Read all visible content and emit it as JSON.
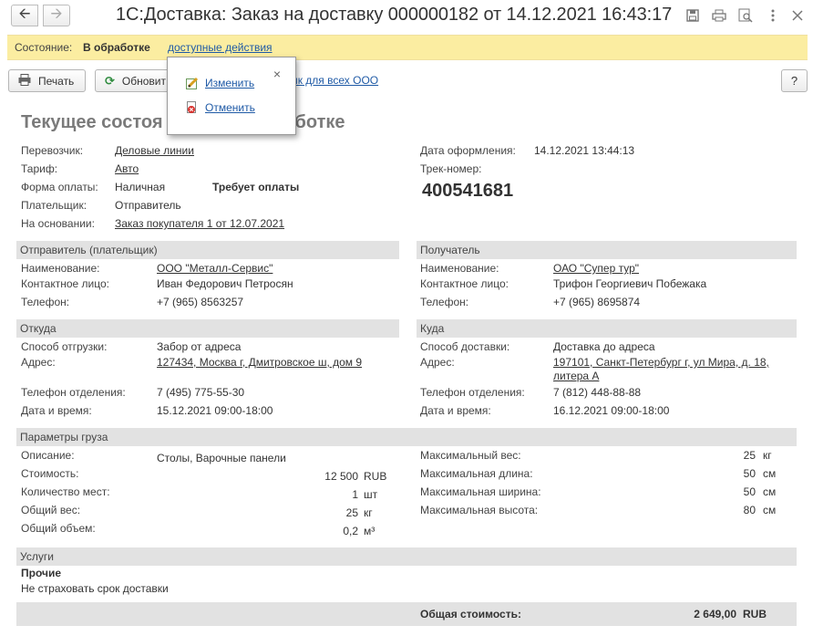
{
  "window": {
    "title": "1С:Доставка: Заказ на доставку 000000182 от 14.12.2021 16:43:17"
  },
  "status": {
    "label": "Состояние:",
    "value": "В обработке",
    "actions_link": "доступные действия"
  },
  "toolbar": {
    "print_label": "Печать",
    "refresh_label": "Обновит",
    "link_label": "ик для всех ООО",
    "help_label": "?"
  },
  "popup": {
    "edit_label": "Изменить",
    "cancel_label": "Отменить",
    "close": "×"
  },
  "heading": {
    "left": "Текущее состоя",
    "right": "ботке"
  },
  "general": {
    "carrier_label": "Перевозчик:",
    "carrier": "Деловые линии",
    "tariff_label": "Тариф:",
    "tariff": "Авто",
    "payment_label": "Форма оплаты:",
    "payment": "Наличная",
    "payment_required": "Требует оплаты",
    "payer_label": "Плательщик:",
    "payer": "Отправитель",
    "basis_label": "На основании:",
    "basis": "Заказ покупателя 1 от 12.07.2021",
    "date_label": "Дата оформления:",
    "date": "14.12.2021 13:44:13",
    "track_label": "Трек-номер:",
    "track": "400541681"
  },
  "sender": {
    "header": "Отправитель (плательщик)",
    "name_label": "Наименование:",
    "name": "ООО \"Металл-Сервис\"",
    "contact_label": "Контактное лицо:",
    "contact": "Иван Федорович Петросян",
    "phone_label": "Телефон:",
    "phone": "+7 (965) 8563257"
  },
  "recipient": {
    "header": "Получатель",
    "name_label": "Наименование:",
    "name": "ОАО \"Супер тур\"",
    "contact_label": "Контактное лицо:",
    "contact": "Трифон Георгиевич Побежака",
    "phone_label": "Телефон:",
    "phone": "+7 (965) 8695874"
  },
  "from": {
    "header": "Откуда",
    "method_label": "Способ отгрузки:",
    "method": "Забор от адреса",
    "address_label": "Адрес:",
    "address": "127434, Москва г, Дмитровское ш, дом 9",
    "branch_phone_label": "Телефон отделения:",
    "branch_phone": "7 (495) 775-55-30",
    "datetime_label": "Дата и время:",
    "datetime": "15.12.2021 09:00-18:00"
  },
  "to": {
    "header": "Куда",
    "method_label": "Способ доставки:",
    "method": "Доставка до адреса",
    "address_label": "Адрес:",
    "address_line1": "197101, Санкт-Петербург г, ул Мира, д. 18,",
    "address_line2": "литера А",
    "branch_phone_label": "Телефон отделения:",
    "branch_phone": "7 (812) 448-88-88",
    "datetime_label": "Дата и время:",
    "datetime": "16.12.2021 09:00-18:00"
  },
  "cargo": {
    "header": "Параметры груза",
    "desc_label": "Описание:",
    "desc": "Столы, Варочные панели",
    "cost_label": "Стоимость:",
    "cost": "12 500",
    "cost_unit": "RUB",
    "places_label": "Количество мест:",
    "places": "1",
    "places_unit": "шт",
    "weight_label": "Общий вес:",
    "weight": "25",
    "weight_unit": "кг",
    "volume_label": "Общий объем:",
    "volume": "0,2",
    "volume_unit": "м³",
    "max_weight_label": "Максимальный вес:",
    "max_weight": "25",
    "max_weight_unit": "кг",
    "max_length_label": "Максимальная длина:",
    "max_length": "50",
    "max_length_unit": "см",
    "max_width_label": "Максимальная ширина:",
    "max_width": "50",
    "max_width_unit": "см",
    "max_height_label": "Максимальная высота:",
    "max_height": "80",
    "max_height_unit": "см"
  },
  "services": {
    "header": "Услуги",
    "group": "Прочие",
    "item": "Не страховать срок доставки"
  },
  "total": {
    "label": "Общая стоимость:",
    "value": "2 649,00",
    "unit": "RUB"
  }
}
